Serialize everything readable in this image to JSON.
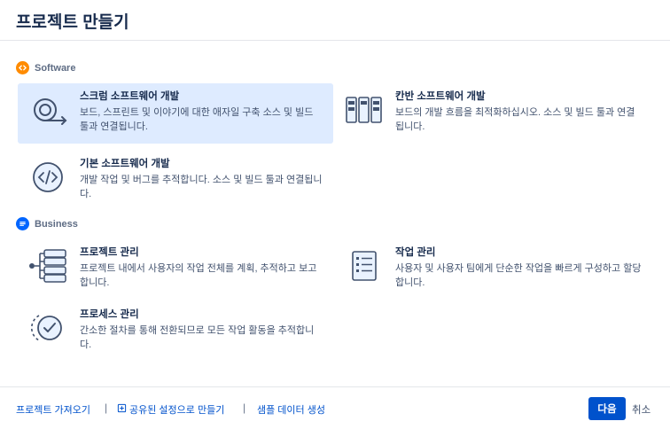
{
  "dialog": {
    "title": "프로젝트 만들기"
  },
  "sections": [
    {
      "label": "Software",
      "icon": "code-badge-icon",
      "color": "#ff8b00",
      "templates": [
        {
          "name": "스크럼 소프트웨어 개발",
          "desc": "보드, 스프린트 및 이야기에 대한 애자일 구축 소스 및 빌드 툴과 연결됩니다.",
          "icon": "scrum-cycle-icon",
          "selected": true
        },
        {
          "name": "칸반 소프트웨어 개발",
          "desc": "보드의 개발 흐름을 최적화하십시오. 소스 및 빌드 툴과 연결됩니다.",
          "icon": "kanban-board-icon",
          "selected": false
        },
        {
          "name": "기본 소프트웨어 개발",
          "desc": "개발 작업 및 버그를 추적합니다. 소스 및 빌드 툴과 연결됩니다.",
          "icon": "code-circle-icon",
          "selected": false
        }
      ]
    },
    {
      "label": "Business",
      "icon": "document-badge-icon",
      "color": "#0065ff",
      "templates": [
        {
          "name": "프로젝트 관리",
          "desc": "프로젝트 내에서 사용자의 작업 전체를 계획, 추적하고 보고합니다.",
          "icon": "project-tree-icon",
          "selected": false
        },
        {
          "name": "작업 관리",
          "desc": "사용자 및 사용자 팀에게 단순한 작업을 빠르게 구성하고 할당합니다.",
          "icon": "task-list-icon",
          "selected": false
        },
        {
          "name": "프로세스 관리",
          "desc": "간소한 절차를 통해 전환되므로 모든 작업 활동을 추적합니다.",
          "icon": "process-check-icon",
          "selected": false
        }
      ]
    }
  ],
  "footer": {
    "import_label": "프로젝트 가져오기",
    "shared_label": "공유된 설정으로 만들기",
    "sample_label": "샘플 데이터 생성",
    "next_label": "다음",
    "cancel_label": "취소"
  },
  "colors": {
    "accent": "#0052cc",
    "selected_bg": "#deebff"
  }
}
